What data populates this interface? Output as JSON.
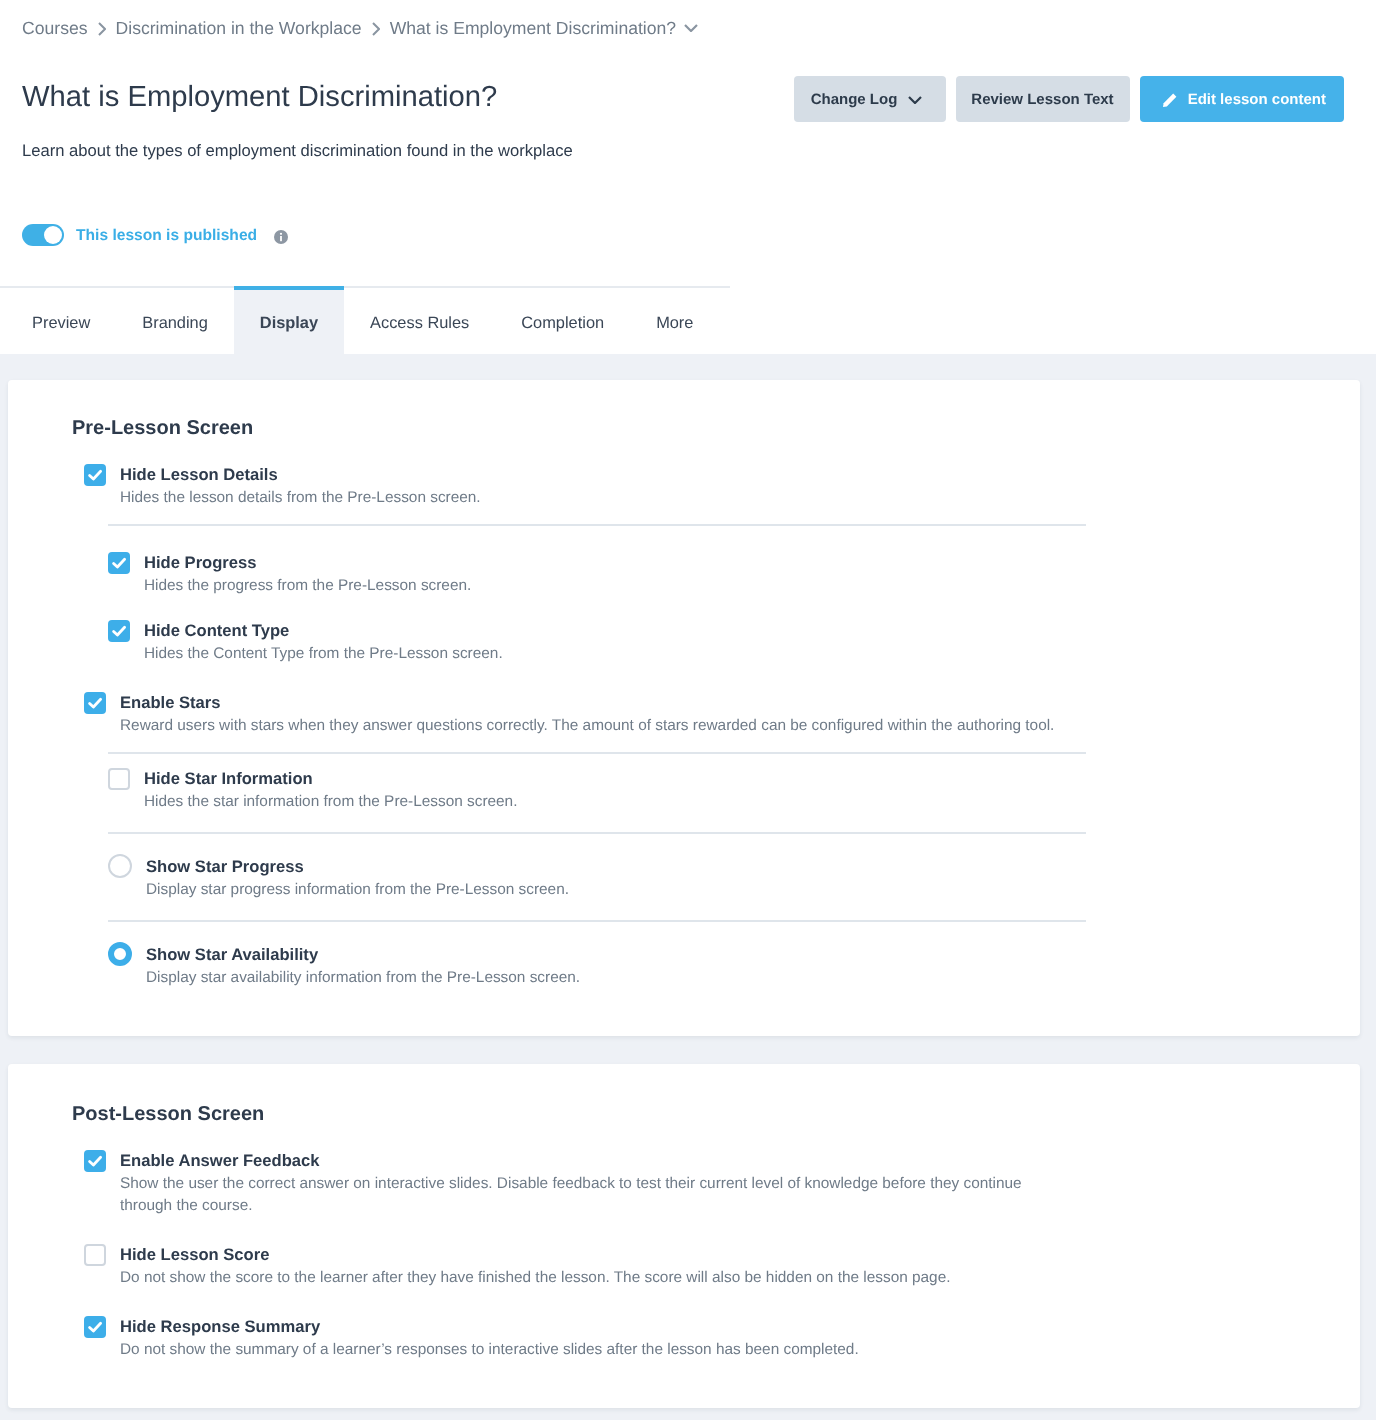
{
  "breadcrumb": [
    {
      "label": "Courses",
      "kind": "link"
    },
    {
      "label": "Discrimination in the Workplace",
      "kind": "link"
    },
    {
      "label": "What is Employment Discrimination?",
      "kind": "dropdown"
    }
  ],
  "lesson": {
    "title": "What is Employment Discrimination?",
    "subtitle": "Learn about the types of employment discrimination found in the workplace"
  },
  "actions": [
    {
      "label": "Change Log",
      "kind": "dropdown"
    },
    {
      "label": "Review Lesson Text",
      "kind": "secondary"
    },
    {
      "label": "Edit lesson content",
      "kind": "primary"
    }
  ],
  "publish": {
    "label": "This lesson is published",
    "on": true
  },
  "tabs": [
    {
      "label": "Preview",
      "selected": false
    },
    {
      "label": "Branding",
      "selected": false
    },
    {
      "label": "Display",
      "selected": true
    },
    {
      "label": "Access Rules",
      "selected": false
    },
    {
      "label": "Completion",
      "selected": false
    },
    {
      "label": "More",
      "selected": false
    }
  ],
  "sections": [
    {
      "title": "Pre-Lesson Screen",
      "options": [
        {
          "kind": "checkbox",
          "label": "Hide Lesson Details",
          "description": "Hides the lesson details from the Pre-Lesson screen.",
          "checked": true,
          "divided": false,
          "children": [
            {
              "kind": "checkbox",
              "label": "Hide Progress",
              "description": "Hides the progress from the Pre-Lesson screen.",
              "checked": true
            },
            {
              "kind": "checkbox",
              "label": "Hide Content Type",
              "description": "Hides the Content Type from the Pre-Lesson screen.",
              "checked": true
            }
          ]
        },
        {
          "kind": "checkbox",
          "label": "Enable Stars",
          "description": "Reward users with stars when they answer questions correctly. The amount of stars rewarded can be configured within the authoring tool.",
          "checked": true,
          "divided": true,
          "children": [
            {
              "kind": "checkbox",
              "label": "Hide Star Information",
              "description": "Hides the star information from the Pre-Lesson screen.",
              "checked": false
            },
            {
              "kind": "radio",
              "label": "Show Star Progress",
              "description": "Display star progress information from the Pre-Lesson screen.",
              "selected": false
            },
            {
              "kind": "radio",
              "label": "Show Star Availability",
              "description": "Display star availability information from the Pre-Lesson screen.",
              "selected": true
            }
          ]
        }
      ]
    },
    {
      "title": "Post-Lesson Screen",
      "options": [
        {
          "kind": "checkbox",
          "label": "Enable Answer Feedback",
          "description": "Show the user the correct answer on interactive slides. Disable feedback to test their current level of knowledge before they continue through the course.",
          "checked": true
        },
        {
          "kind": "checkbox",
          "label": "Hide Lesson Score",
          "description": "Do not show the score to the learner after they have finished the lesson. The score will also be hidden on the lesson page.",
          "checked": false
        },
        {
          "kind": "checkbox",
          "label": "Hide Response Summary",
          "description": "Do not show the summary of a learner’s responses to interactive slides after the lesson has been completed.",
          "checked": true
        }
      ]
    }
  ]
}
